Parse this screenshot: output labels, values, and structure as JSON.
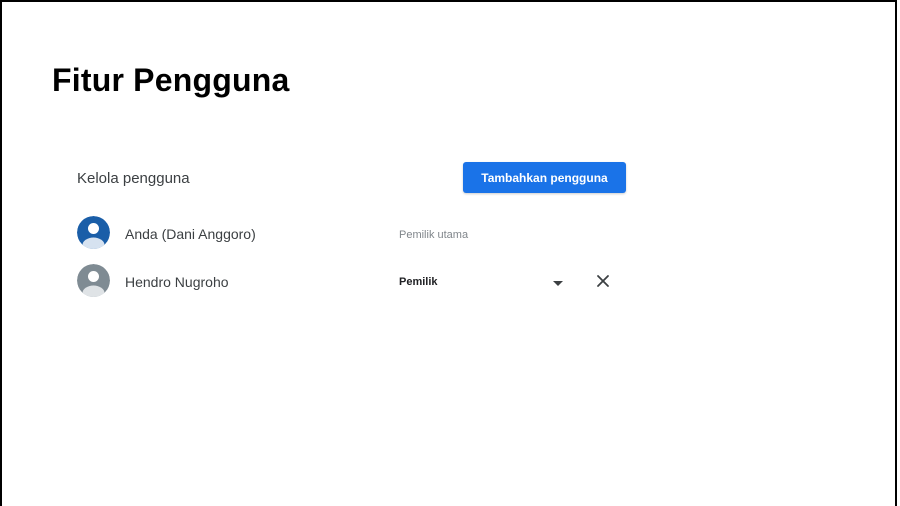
{
  "page": {
    "title": "Fitur Pengguna"
  },
  "users_panel": {
    "section_label": "Kelola pengguna",
    "add_button_label": "Tambahkan pengguna",
    "users": [
      {
        "name": "Anda (Dani Anggoro)",
        "role": "Pemilik utama",
        "role_editable": false,
        "avatar_color": "#1a5ea8"
      },
      {
        "name": "Hendro Nugroho",
        "role": "Pemilik",
        "role_editable": true,
        "avatar_color": "#7f8b93"
      }
    ]
  },
  "icons": {
    "avatar": "person-icon",
    "dropdown": "chevron-down-icon",
    "remove": "close-icon"
  },
  "colors": {
    "accent": "#1a73e8",
    "avatar_primary": "#1a5ea8",
    "avatar_secondary": "#7f8b93"
  }
}
